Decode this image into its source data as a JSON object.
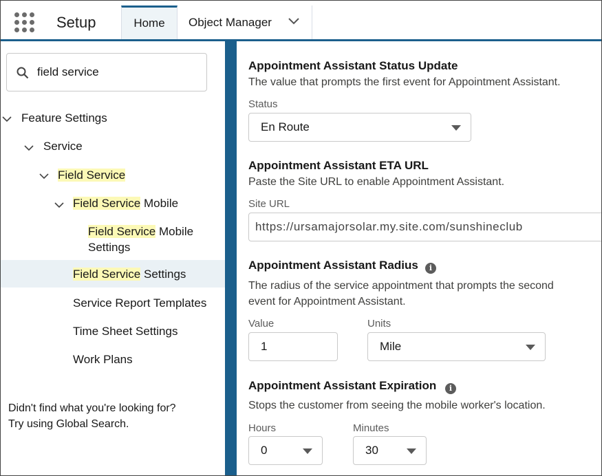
{
  "header": {
    "app_title": "Setup",
    "tabs": [
      {
        "label": "Home"
      },
      {
        "label": "Object Manager"
      }
    ]
  },
  "sidebar": {
    "search_value": "field service",
    "tree": {
      "feature_settings": "Feature Settings",
      "service": "Service",
      "field_service": "Field Service",
      "fs_mobile_hl": "Field Service",
      "fs_mobile_rest": " Mobile",
      "fs_mobile_settings_hl": "Field Service",
      "fs_mobile_settings_rest1": " Mobile",
      "fs_mobile_settings_rest2": "Settings",
      "fs_settings_hl": "Field Service",
      "fs_settings_rest": " Settings",
      "service_report_templates": "Service Report Templates",
      "time_sheet_settings": "Time Sheet Settings",
      "work_plans": "Work Plans"
    },
    "help_line1": "Didn't find what you're looking for?",
    "help_line2": "Try using Global Search."
  },
  "main": {
    "status_update": {
      "title": "Appointment Assistant Status Update",
      "desc": "The value that prompts the first event for Appointment Assistant.",
      "label": "Status",
      "value": "En Route"
    },
    "eta_url": {
      "title": "Appointment Assistant ETA URL",
      "desc": "Paste the Site URL to enable Appointment Assistant.",
      "label": "Site URL",
      "value": "https://ursamajorsolar.my.site.com/sunshineclub"
    },
    "radius": {
      "title": "Appointment Assistant Radius",
      "desc_line1": "The radius of the service appointment that prompts the second",
      "desc_line2": "event for Appointment Assistant.",
      "value_label": "Value",
      "value": "1",
      "units_label": "Units",
      "units": "Mile"
    },
    "expiration": {
      "title": "Appointment Assistant Expiration",
      "desc": "Stops the customer from seeing the mobile worker's location.",
      "hours_label": "Hours",
      "hours": "0",
      "minutes_label": "Minutes",
      "minutes": "30"
    }
  },
  "icons": {
    "app_launcher": "waffle-grid-icon",
    "search": "search-icon",
    "info": "info-icon",
    "chevron": "chevron-down-icon"
  }
}
